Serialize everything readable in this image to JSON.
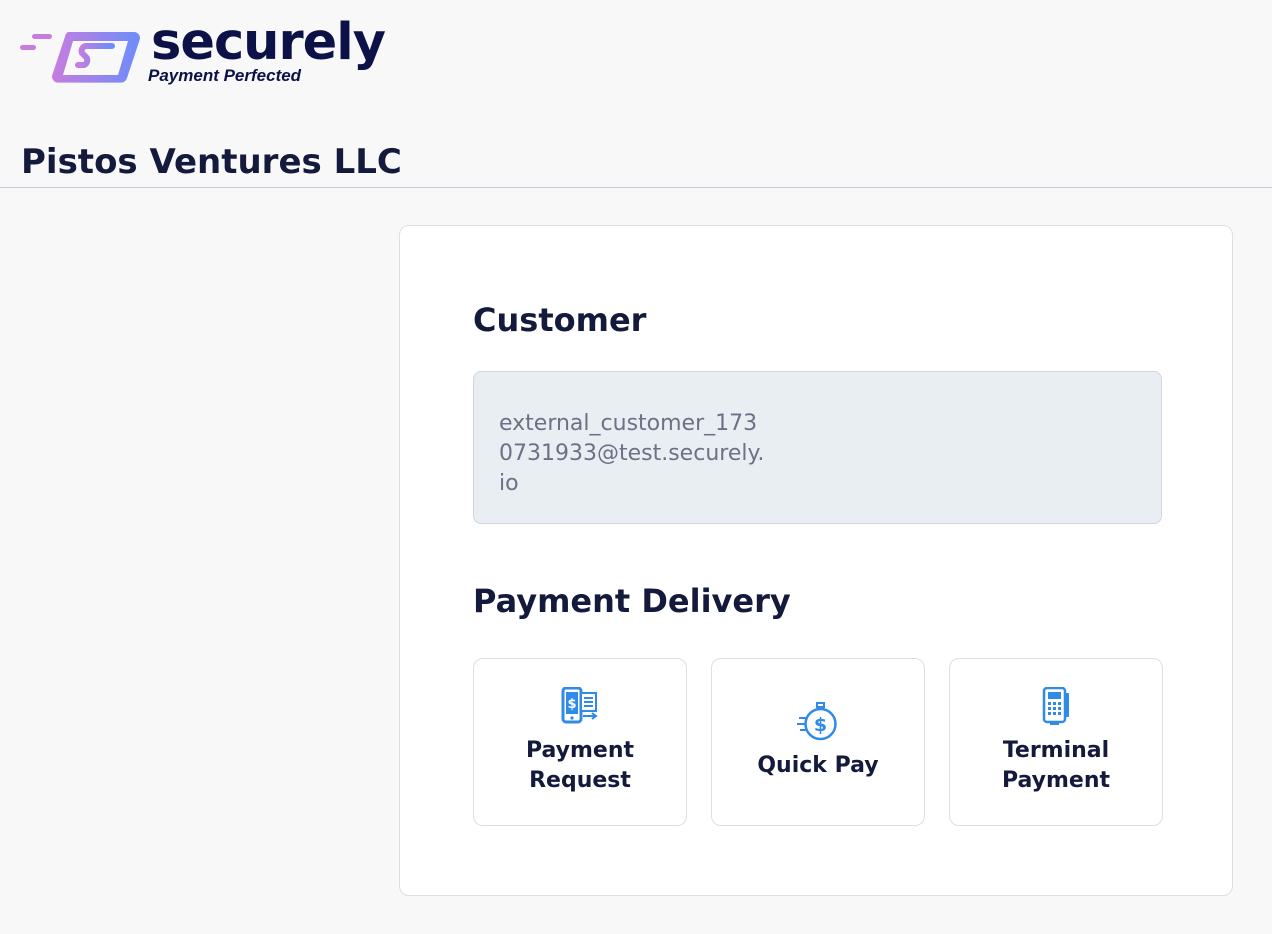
{
  "brand": {
    "name": "securely",
    "tagline": "Payment Perfected",
    "gradient_start": "#c77dde",
    "gradient_end": "#6b8dfb",
    "text_color": "#0c1247"
  },
  "merchant": {
    "name": "Pistos Ventures LLC"
  },
  "customer": {
    "title": "Customer",
    "email": "external_customer_1730731933@test.securely.io"
  },
  "payment_delivery": {
    "title": "Payment Delivery",
    "options": [
      {
        "label_line1": "Payment",
        "label_line2": "Request",
        "icon": "payment-request-icon"
      },
      {
        "label": "Quick Pay",
        "icon": "quick-pay-icon"
      },
      {
        "label_line1": "Terminal",
        "label_line2": "Payment",
        "icon": "terminal-payment-icon"
      }
    ],
    "icon_color": "#2f8ae8"
  }
}
